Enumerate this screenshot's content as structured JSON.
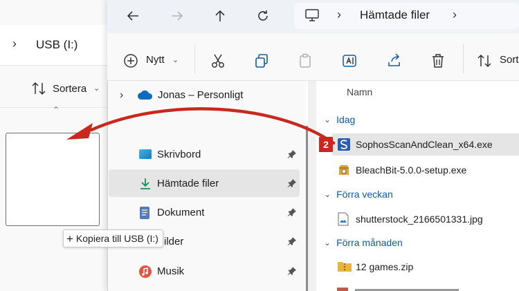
{
  "left_window": {
    "address": "USB (I:)",
    "sort_label": "Sortera",
    "drag_tooltip": "Kopiera till USB (I:)"
  },
  "title_bar": {
    "breadcrumb": "Hämtade filer"
  },
  "toolbar": {
    "new_label": "Nytt",
    "sort_label": "Sort"
  },
  "nav_pane": {
    "onedrive_label": "Jonas – Personligt",
    "items": [
      {
        "label": "Skrivbord",
        "icon": "desktop-icon"
      },
      {
        "label": "Hämtade filer",
        "icon": "download-icon",
        "selected": true
      },
      {
        "label": "Dokument",
        "icon": "document-icon"
      },
      {
        "label": "Bilder",
        "icon": "pictures-icon"
      },
      {
        "label": "Musik",
        "icon": "music-icon"
      }
    ]
  },
  "file_list": {
    "column_name": "Namn",
    "groups": [
      {
        "label": "Idag",
        "files": [
          {
            "name": "SophosScanAndClean_x64.exe",
            "selected": true,
            "icon": "sophos-icon"
          },
          {
            "name": "BleachBit-5.0.0-setup.exe",
            "icon": "installer-icon"
          }
        ]
      },
      {
        "label": "Förra veckan",
        "files": [
          {
            "name": "shutterstock_2166501331.jpg",
            "icon": "image-file-icon"
          }
        ]
      },
      {
        "label": "Förra månaden",
        "files": [
          {
            "name": "12 games.zip",
            "icon": "zip-folder-icon"
          }
        ]
      }
    ]
  },
  "annotation": {
    "step_number": "2",
    "arrow_color": "#c8281e"
  }
}
